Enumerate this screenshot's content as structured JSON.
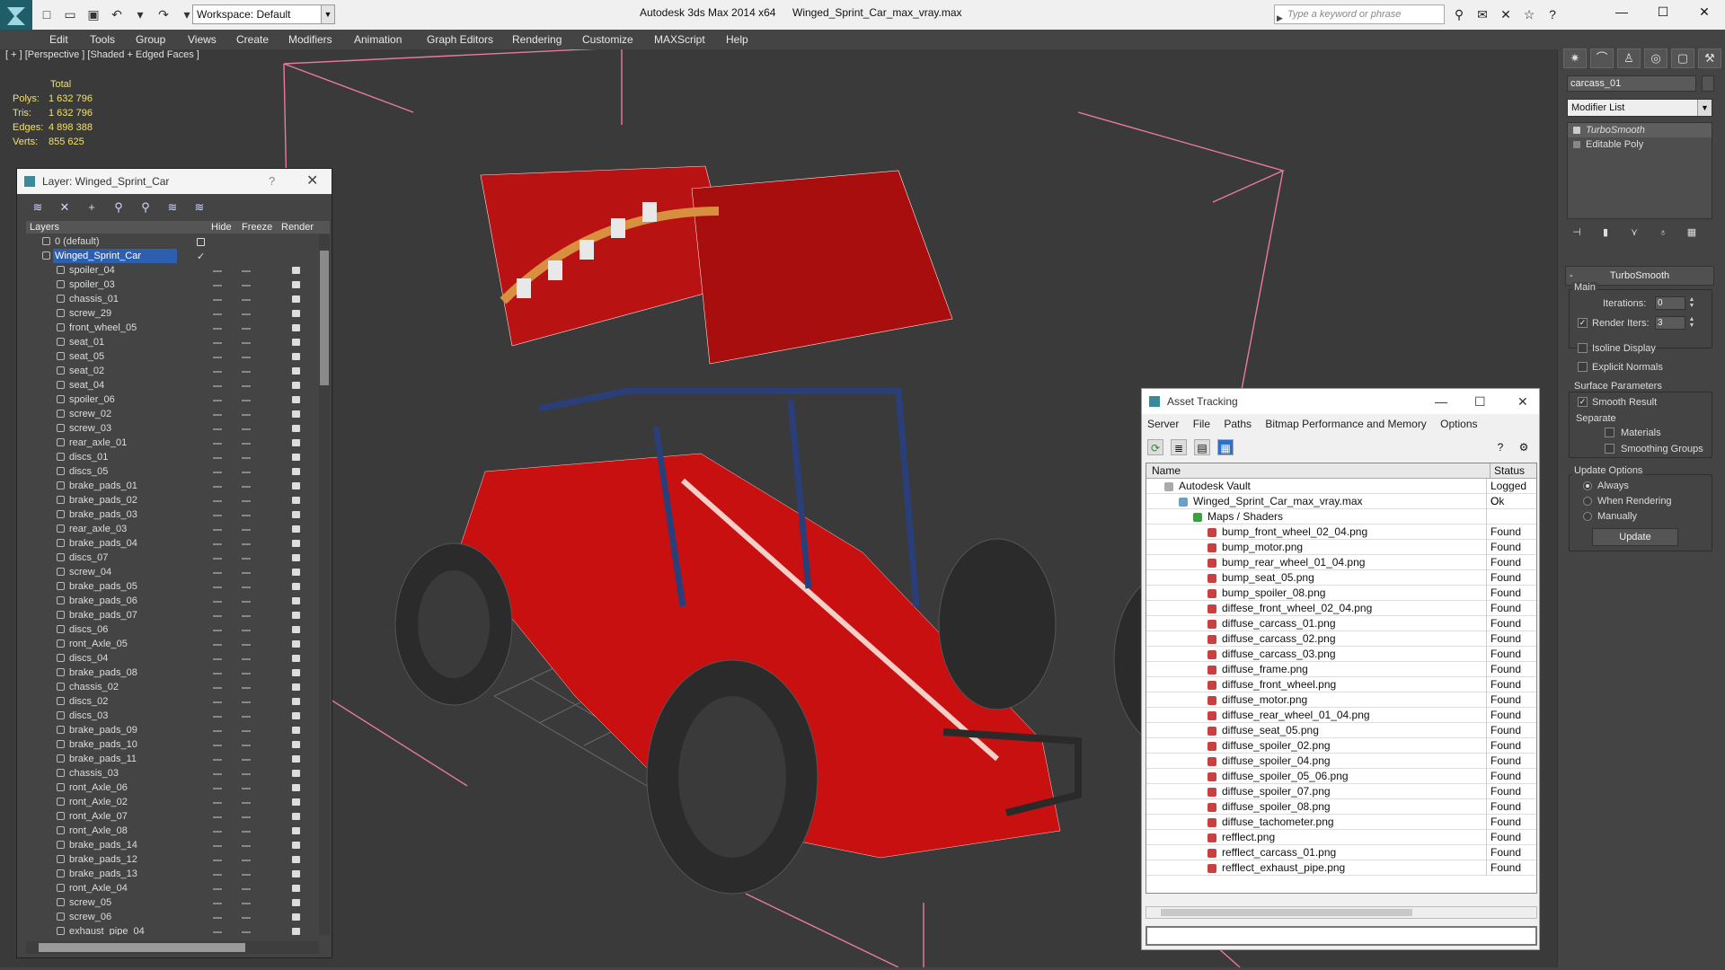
{
  "app": {
    "title": "Autodesk 3ds Max 2014 x64",
    "file": "Winged_Sprint_Car_max_vray.max",
    "workspace": "Workspace: Default",
    "search_placeholder": "Type a keyword or phrase"
  },
  "menu": [
    "Edit",
    "Tools",
    "Group",
    "Views",
    "Create",
    "Modifiers",
    "Animation",
    "Graph Editors",
    "Rendering",
    "Customize",
    "MAXScript",
    "Help"
  ],
  "viewport": {
    "label": "[ + ] [Perspective ] [Shaded + Edged Faces ]",
    "stats_header": "Total",
    "stats": [
      {
        "k": "Polys:",
        "v": "1 632 796"
      },
      {
        "k": "Tris:",
        "v": "1 632 796"
      },
      {
        "k": "Edges:",
        "v": "4 898 388"
      },
      {
        "k": "Verts:",
        "v": "855 625"
      }
    ]
  },
  "layers": {
    "title": "Layer: Winged_Sprint_Car",
    "columns": [
      "Layers",
      "Hide",
      "Freeze",
      "Render"
    ],
    "default": "0 (default)",
    "selected": "Winged_Sprint_Car",
    "items": [
      "spoiler_04",
      "spoiler_03",
      "chassis_01",
      "screw_29",
      "front_wheel_05",
      "seat_01",
      "seat_05",
      "seat_02",
      "seat_04",
      "spoiler_06",
      "screw_02",
      "screw_03",
      "rear_axle_01",
      "discs_01",
      "discs_05",
      "brake_pads_01",
      "brake_pads_02",
      "brake_pads_03",
      "rear_axle_03",
      "brake_pads_04",
      "discs_07",
      "screw_04",
      "brake_pads_05",
      "brake_pads_06",
      "brake_pads_07",
      "discs_06",
      "ront_Axle_05",
      "discs_04",
      "brake_pads_08",
      "chassis_02",
      "discs_02",
      "discs_03",
      "brake_pads_09",
      "brake_pads_10",
      "brake_pads_11",
      "chassis_03",
      "ront_Axle_06",
      "ront_Axle_02",
      "ront_Axle_07",
      "ront_Axle_08",
      "brake_pads_14",
      "brake_pads_12",
      "brake_pads_13",
      "ront_Axle_04",
      "screw_05",
      "screw_06",
      "exhaust_pipe_04"
    ]
  },
  "asset": {
    "title": "Asset Tracking",
    "menu": [
      "Server",
      "File",
      "Paths",
      "Bitmap Performance and Memory",
      "Options"
    ],
    "columns": [
      "Name",
      "Status"
    ],
    "vault": {
      "name": "Autodesk Vault",
      "status": "Logged O"
    },
    "file": {
      "name": "Winged_Sprint_Car_max_vray.max",
      "status": "Ok"
    },
    "folder": "Maps / Shaders",
    "maps": [
      "bump_front_wheel_02_04.png",
      "bump_motor.png",
      "bump_rear_wheel_01_04.png",
      "bump_seat_05.png",
      "bump_spoiler_08.png",
      "diffese_front_wheel_02_04.png",
      "diffuse_carcass_01.png",
      "diffuse_carcass_02.png",
      "diffuse_carcass_03.png",
      "diffuse_frame.png",
      "diffuse_front_wheel.png",
      "diffuse_motor.png",
      "diffuse_rear_wheel_01_04.png",
      "diffuse_seat_05.png",
      "diffuse_spoiler_02.png",
      "diffuse_spoiler_04.png",
      "diffuse_spoiler_05_06.png",
      "diffuse_spoiler_07.png",
      "diffuse_spoiler_08.png",
      "diffuse_tachometer.png",
      "refflect.png",
      "refflect_carcass_01.png",
      "refflect_exhaust_pipe.png"
    ],
    "found": "Found"
  },
  "command": {
    "object_name": "carcass_01",
    "modifier_list": "Modifier List",
    "stack": [
      "TurboSmooth",
      "Editable Poly"
    ],
    "rollout": "TurboSmooth",
    "main": "Main",
    "iterations_label": "Iterations:",
    "iterations": "0",
    "render_iters_label": "Render Iters:",
    "render_iters": "3",
    "isoline": "Isoline Display",
    "explicit": "Explicit Normals",
    "surface": "Surface Parameters",
    "smooth": "Smooth Result",
    "separate": "Separate",
    "materials": "Materials",
    "smoothing_groups": "Smoothing Groups",
    "update_options": "Update Options",
    "always": "Always",
    "when_rendering": "When Rendering",
    "manually": "Manually",
    "update": "Update"
  },
  "colors": {
    "accent": "#2d5fb0",
    "car_red": "#c81010",
    "frame_blue": "#2a3f7a",
    "stats": "#f0e070",
    "bbox": "#e87aa0"
  }
}
